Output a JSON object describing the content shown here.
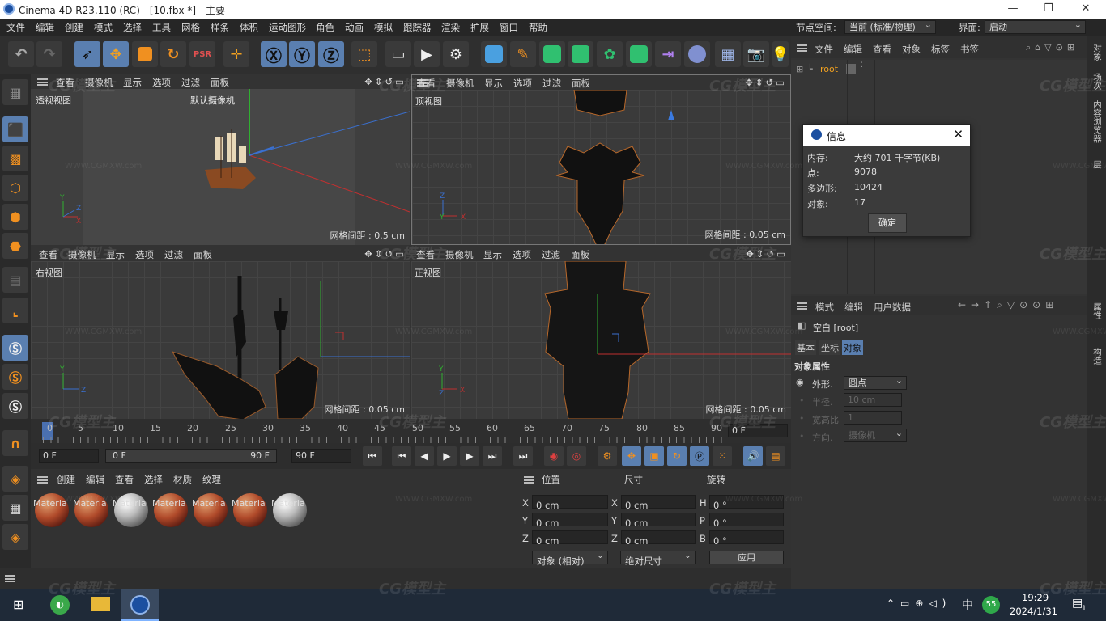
{
  "window": {
    "title": "Cinema 4D R23.110 (RC) - [10.fbx *] - 主要"
  },
  "menu": {
    "items": [
      "文件",
      "编辑",
      "创建",
      "模式",
      "选择",
      "工具",
      "网格",
      "样条",
      "体积",
      "运动图形",
      "角色",
      "动画",
      "模拟",
      "跟踪器",
      "渲染",
      "扩展",
      "窗口",
      "帮助"
    ],
    "node_space_label": "节点空间:",
    "node_space_value": "当前 (标准/物理)",
    "layout_label": "界面:",
    "layout_value": "启动"
  },
  "viewports": [
    {
      "menu": [
        "查看",
        "摄像机",
        "显示",
        "选项",
        "过滤",
        "面板"
      ],
      "name": "透视视图",
      "camera": "默认摄像机",
      "grid": "网格间距 : 0.5 cm"
    },
    {
      "menu": [
        "查看",
        "摄像机",
        "显示",
        "选项",
        "过滤",
        "面板"
      ],
      "name": "顶视图",
      "grid": "网格间距 : 0.05 cm"
    },
    {
      "menu": [
        "查看",
        "摄像机",
        "显示",
        "选项",
        "过滤",
        "面板"
      ],
      "name": "右视图",
      "grid": "网格间距 : 0.05 cm"
    },
    {
      "menu": [
        "查看",
        "摄像机",
        "显示",
        "选项",
        "过滤",
        "面板"
      ],
      "name": "正视图",
      "grid": "网格间距 : 0.05 cm"
    }
  ],
  "timeline": {
    "ticks": [
      "0",
      "5",
      "10",
      "15",
      "20",
      "25",
      "30",
      "35",
      "40",
      "45",
      "50",
      "55",
      "60",
      "65",
      "70",
      "75",
      "80",
      "85",
      "90"
    ],
    "end_label": "0 F",
    "current": "0 F",
    "range_start": "0 F",
    "range_end": "90 F",
    "max": "90 F"
  },
  "materials": {
    "menu": [
      "创建",
      "编辑",
      "查看",
      "选择",
      "材质",
      "纹理"
    ],
    "items": [
      {
        "label": "Materia",
        "kind": "red"
      },
      {
        "label": "Materia",
        "kind": "red"
      },
      {
        "label": "Materia",
        "kind": "white"
      },
      {
        "label": "Materia",
        "kind": "red"
      },
      {
        "label": "Materia",
        "kind": "red"
      },
      {
        "label": "Materia",
        "kind": "red"
      },
      {
        "label": "Materia",
        "kind": "white"
      }
    ]
  },
  "coords": {
    "headers": [
      "位置",
      "尺寸",
      "旋转"
    ],
    "pos": {
      "x": "0 cm",
      "y": "0 cm",
      "z": "0 cm"
    },
    "size": {
      "x": "0 cm",
      "y": "0 cm",
      "z": "0 cm"
    },
    "rot": {
      "h": "0 °",
      "p": "0 °",
      "b": "0 °"
    },
    "mode": "对象 (相对)",
    "size_mode": "绝对尺寸",
    "apply": "应用"
  },
  "objects": {
    "menu": [
      "文件",
      "编辑",
      "查看",
      "对象",
      "标签",
      "书签"
    ],
    "root": "root"
  },
  "info_dialog": {
    "title": "信息",
    "rows": [
      {
        "label": "内存:",
        "value": "大约 701 千字节(KB)"
      },
      {
        "label": "点:",
        "value": "9078"
      },
      {
        "label": "多边形:",
        "value": "10424"
      },
      {
        "label": "对象:",
        "value": "17"
      }
    ],
    "ok": "确定"
  },
  "attributes": {
    "menu": [
      "模式",
      "编辑",
      "用户数据"
    ],
    "object_name": "空白 [root]",
    "tabs": [
      "基本",
      "坐标",
      "对象"
    ],
    "section": "对象属性",
    "props": [
      {
        "label": "外形.",
        "value": "圆点"
      },
      {
        "label": "半径.",
        "value": "10 cm"
      },
      {
        "label": "宽高比",
        "value": "1"
      },
      {
        "label": "方向.",
        "value": "摄像机"
      }
    ]
  },
  "side_tabs": [
    "对象",
    "场次",
    "内容浏览器",
    "层",
    "属性",
    "构造"
  ],
  "taskbar": {
    "time": "19:29",
    "date": "2024/1/31",
    "ime": "中",
    "badge": "55",
    "notif": "1"
  },
  "watermark": {
    "brand": "CG模型主",
    "url": "WWW.CGMXW.com"
  }
}
